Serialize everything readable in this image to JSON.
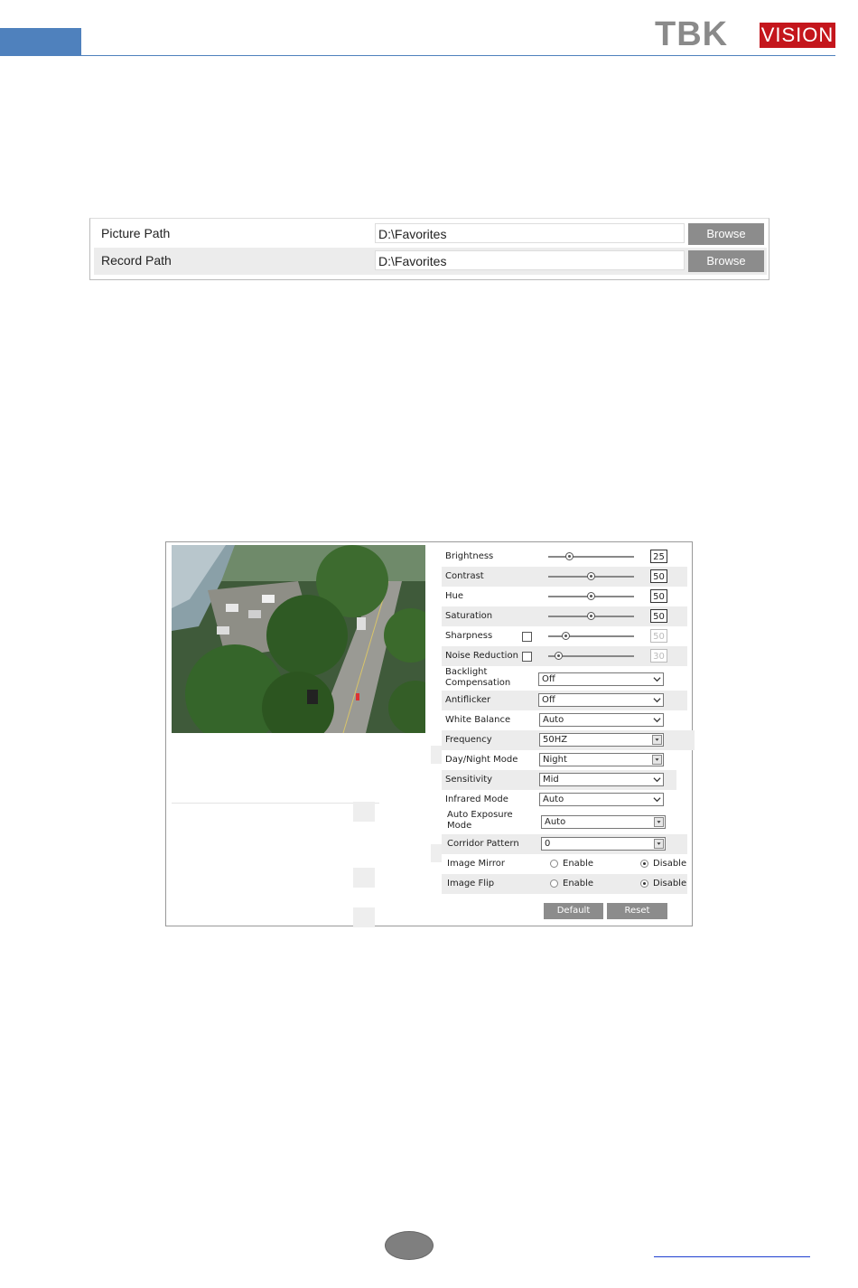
{
  "brand": {
    "logo_left": "TBK",
    "logo_right": "VISION",
    "accent": "#4f81bd",
    "logo_red": "#c4161c",
    "logo_gray": "#8a8a8a"
  },
  "paths": [
    {
      "label": "Picture Path",
      "value": "D:\\Favorites",
      "button": "Browse"
    },
    {
      "label": "Record Path",
      "value": "D:\\Favorites",
      "button": "Browse"
    }
  ],
  "image_settings": {
    "sliders": [
      {
        "label": "Brightness",
        "value": "25",
        "level": 25,
        "checkbox": false,
        "enabled": true
      },
      {
        "label": "Contrast",
        "value": "50",
        "level": 50,
        "checkbox": false,
        "enabled": true
      },
      {
        "label": "Hue",
        "value": "50",
        "level": 50,
        "checkbox": false,
        "enabled": true
      },
      {
        "label": "Saturation",
        "value": "50",
        "level": 50,
        "checkbox": false,
        "enabled": true
      },
      {
        "label": "Sharpness",
        "value": "50",
        "level": 20,
        "checkbox": true,
        "enabled": false
      },
      {
        "label": "Noise Reduction",
        "value": "30",
        "level": 12,
        "checkbox": true,
        "enabled": false
      }
    ],
    "selects": [
      {
        "label_lines": [
          "Backlight",
          "Compensation"
        ],
        "value": "Off",
        "style": "chevron"
      },
      {
        "label_lines": [
          "Antiflicker"
        ],
        "value": "Off",
        "style": "chevron"
      },
      {
        "label_lines": [
          "White Balance"
        ],
        "value": "Auto",
        "style": "chevron"
      },
      {
        "label_lines": [
          "Frequency"
        ],
        "value": "50HZ",
        "style": "boxed"
      },
      {
        "label_lines": [
          "Day/Night Mode"
        ],
        "value": "Night",
        "style": "boxed"
      },
      {
        "label_lines": [
          "Sensitivity"
        ],
        "value": "Mid",
        "style": "chevron"
      },
      {
        "label_lines": [
          "Infrared Mode"
        ],
        "value": "Auto",
        "style": "chevron"
      },
      {
        "label_lines": [
          "Auto Exposure",
          "Mode"
        ],
        "value": "Auto",
        "style": "boxed"
      },
      {
        "label_lines": [
          "Corridor Pattern"
        ],
        "value": "0",
        "style": "boxed"
      }
    ],
    "radios": [
      {
        "label": "Image Mirror",
        "enable": "Enable",
        "disable": "Disable",
        "selected": "Disable"
      },
      {
        "label": "Image Flip",
        "enable": "Enable",
        "disable": "Disable",
        "selected": "Disable"
      }
    ],
    "buttons": {
      "default": "Default",
      "reset": "Reset"
    }
  }
}
